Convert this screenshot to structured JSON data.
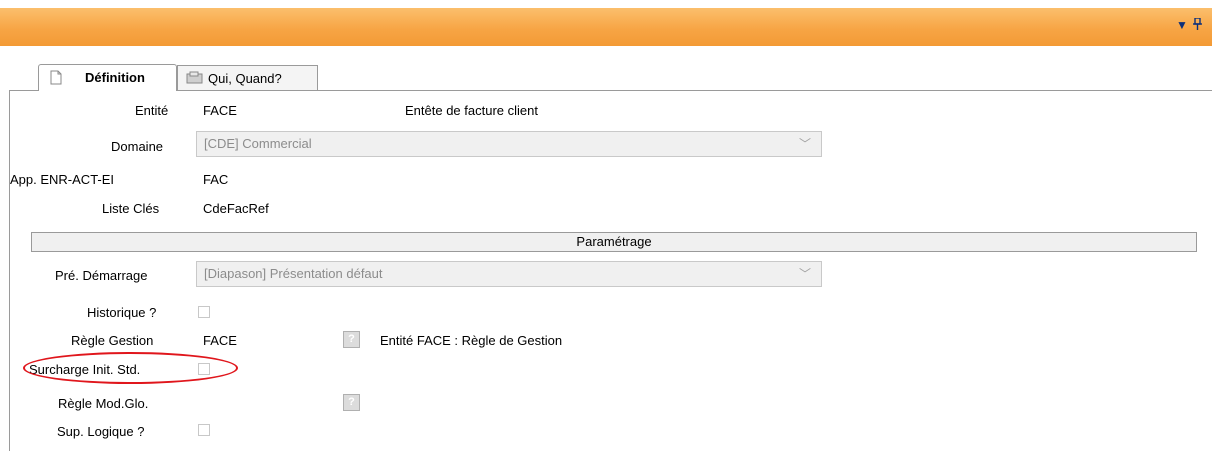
{
  "title_bar": {
    "dropdown_icon": "dropdown-arrow-icon",
    "pin_icon": "pin-icon",
    "accent": "#f7a545"
  },
  "tabs": [
    {
      "label": "Définition",
      "icon": "document-icon",
      "active": true
    },
    {
      "label": "Qui, Quand?",
      "icon": "users-icon",
      "active": false
    }
  ],
  "form": {
    "entite": {
      "label": "Entité",
      "value": "FACE",
      "description": "Entête de facture client"
    },
    "domaine": {
      "label": "Domaine",
      "value": "[CDE] Commercial"
    },
    "app": {
      "label": "App. ENR-ACT-EI",
      "value": "FAC"
    },
    "liste_cles": {
      "label": "Liste Clés",
      "value": "CdeFacRef"
    },
    "section_title": "Paramétrage",
    "pre_demarrage": {
      "label": "Pré. Démarrage",
      "value": "[Diapason] Présentation défaut"
    },
    "historique": {
      "label": "Historique ?",
      "checked": false
    },
    "regle_gestion": {
      "label": "Règle Gestion",
      "value": "FACE",
      "help": "?",
      "description": "Entité FACE : Règle de Gestion"
    },
    "surcharge": {
      "label": "Surcharge Init. Std.",
      "checked": false,
      "highlight_color": "#e0161c"
    },
    "regle_mod": {
      "label": "Règle Mod.Glo.",
      "help": "?"
    },
    "sup_logique": {
      "label": "Sup. Logique ?",
      "checked": false
    }
  }
}
